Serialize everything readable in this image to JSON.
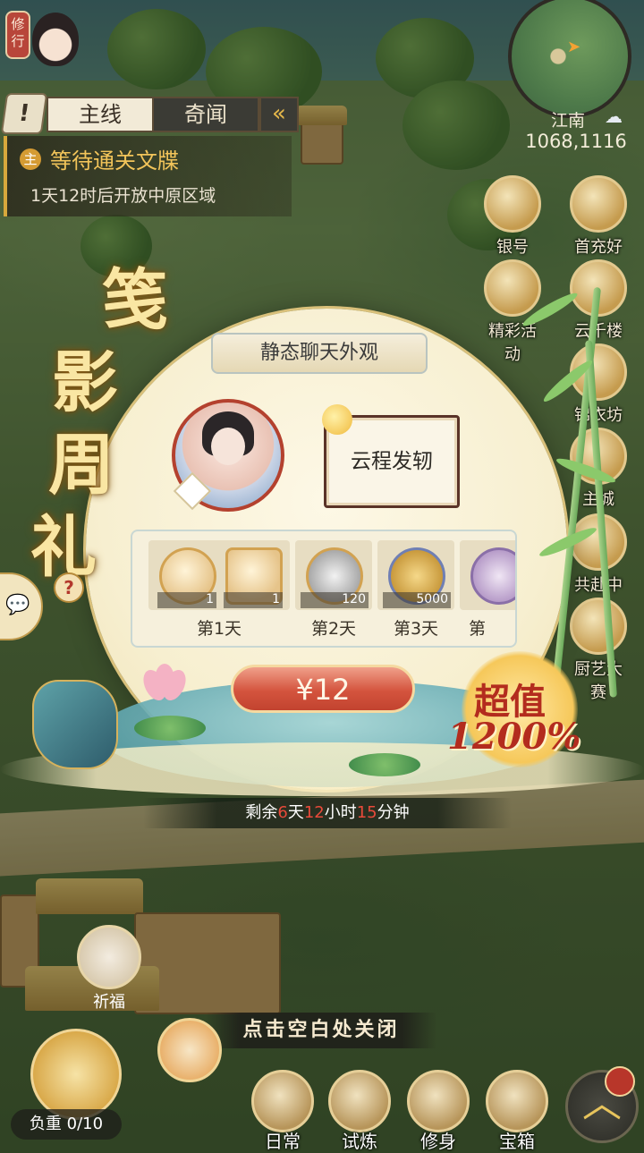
{
  "hud": {
    "cultivate_label": "修行",
    "tab_icon": "!",
    "tab_main": "主线",
    "tab_odd": "奇闻",
    "tab_collapse_icon": "double-chevron-left-icon",
    "quest_badge": "主",
    "quest_title": "等待通关文牒",
    "quest_sub": "1天12时后开放中原区域",
    "region": "江南",
    "coords": "1068,1116",
    "weather_icon": "thunder-cloud-icon"
  },
  "side_menu": [
    {
      "label": "银号",
      "icon": "bank-icon"
    },
    {
      "label": "首充好礼",
      "icon": "gift-bag-icon"
    },
    {
      "label": "精彩活动",
      "icon": "event-icon"
    },
    {
      "label": "云千楼",
      "icon": "tower-icon"
    },
    {
      "label": "锦衣坊",
      "icon": "tailor-icon"
    },
    {
      "label": "主城",
      "icon": "city-icon"
    },
    {
      "label": "共赴中原",
      "icon": "march-icon"
    },
    {
      "label": "厨艺大赛",
      "icon": "cooking-icon"
    }
  ],
  "promo": {
    "title_chars": [
      "笺",
      "影",
      "周",
      "礼"
    ],
    "help_icon": "?",
    "item_title": "静态聊天外观",
    "bubble_text": "云程发轫",
    "rewards": [
      {
        "day": "第1天",
        "items": [
          {
            "icon": "chat-frame-icon",
            "count": "1"
          },
          {
            "icon": "chat-bubble-icon",
            "count": "1"
          }
        ]
      },
      {
        "day": "第2天",
        "items": [
          {
            "icon": "silver-ingot-icon",
            "count": "120"
          }
        ]
      },
      {
        "day": "第3天",
        "items": [
          {
            "icon": "copper-coins-icon",
            "count": "5000"
          }
        ]
      },
      {
        "day": "第",
        "items": [
          {
            "icon": "amulet-icon",
            "count": ""
          }
        ]
      }
    ],
    "price": "¥12",
    "deal_line1": "超值",
    "deal_line2": "1200%",
    "countdown": {
      "prefix": "剩余",
      "days": "6",
      "days_unit": "天",
      "hours": "12",
      "hours_unit": "小时",
      "minutes": "15",
      "minutes_unit": "分钟"
    },
    "close_hint": "点击空白处关闭"
  },
  "bottom": {
    "pray": "祈福",
    "load": "负重 0/10",
    "nav": [
      {
        "label": "日常",
        "icon": "scroll-icon"
      },
      {
        "label": "试炼",
        "icon": "hat-icon"
      },
      {
        "label": "修身",
        "icon": "book-icon"
      },
      {
        "label": "宝箱",
        "icon": "chest-icon"
      }
    ],
    "home_icon": "roof-chevron-icon"
  },
  "colors": {
    "accent_red": "#c2432f",
    "gold": "#d7a83c",
    "highlight_red": "#e94a3a"
  }
}
